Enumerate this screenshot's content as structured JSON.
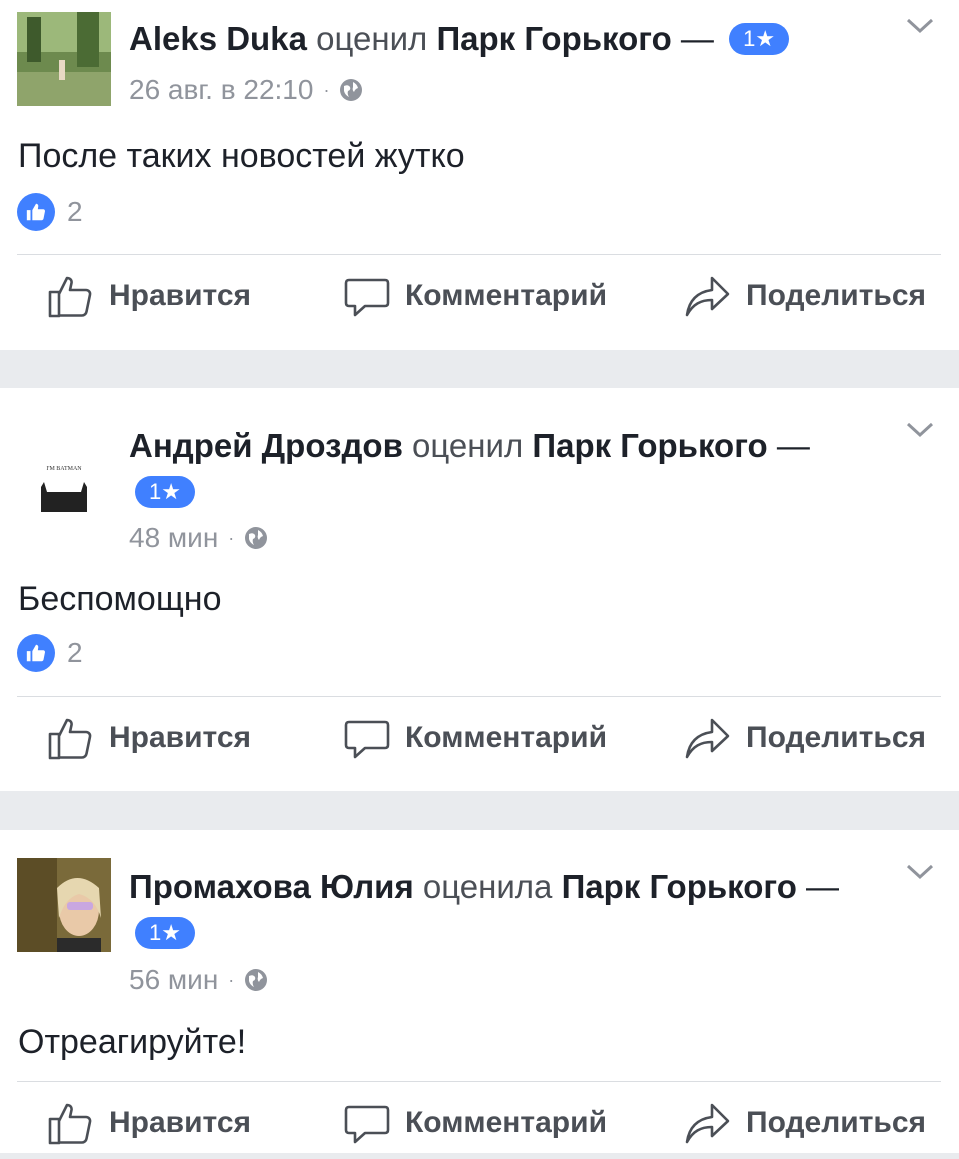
{
  "posts": [
    {
      "author": "Aleks Duka",
      "verb": "оценил",
      "page": "Парк Горького",
      "dash": "—",
      "rating": "1★",
      "time": "26 авг. в 22:10",
      "dot": "·",
      "text": "После таких новостей жутко",
      "likes": "2"
    },
    {
      "author": "Андрей Дроздов",
      "verb": "оценил",
      "page": "Парк Горького",
      "dash": "—",
      "rating": "1★",
      "time": "48 мин",
      "dot": "·",
      "text": "Беспомощно",
      "likes": "2",
      "avatar_text": "I'M BATMAN"
    },
    {
      "author": "Промахова Юлия",
      "verb": "оценила",
      "page": "Парк Горького",
      "dash": "—",
      "rating": "1★",
      "time": "56 мин",
      "dot": "·",
      "text": "Отреагируйте!"
    }
  ],
  "actions": {
    "like": "Нравится",
    "comment": "Комментарий",
    "share": "Поделиться"
  },
  "colors": {
    "accent": "#4080ff",
    "background": "#e9ebee",
    "muted": "#90949c",
    "action_text": "#4b4f56"
  },
  "icons": [
    "globe-icon",
    "chevron-down-icon",
    "like-badge-icon",
    "thumbs-up-icon",
    "comment-icon",
    "share-icon"
  ]
}
